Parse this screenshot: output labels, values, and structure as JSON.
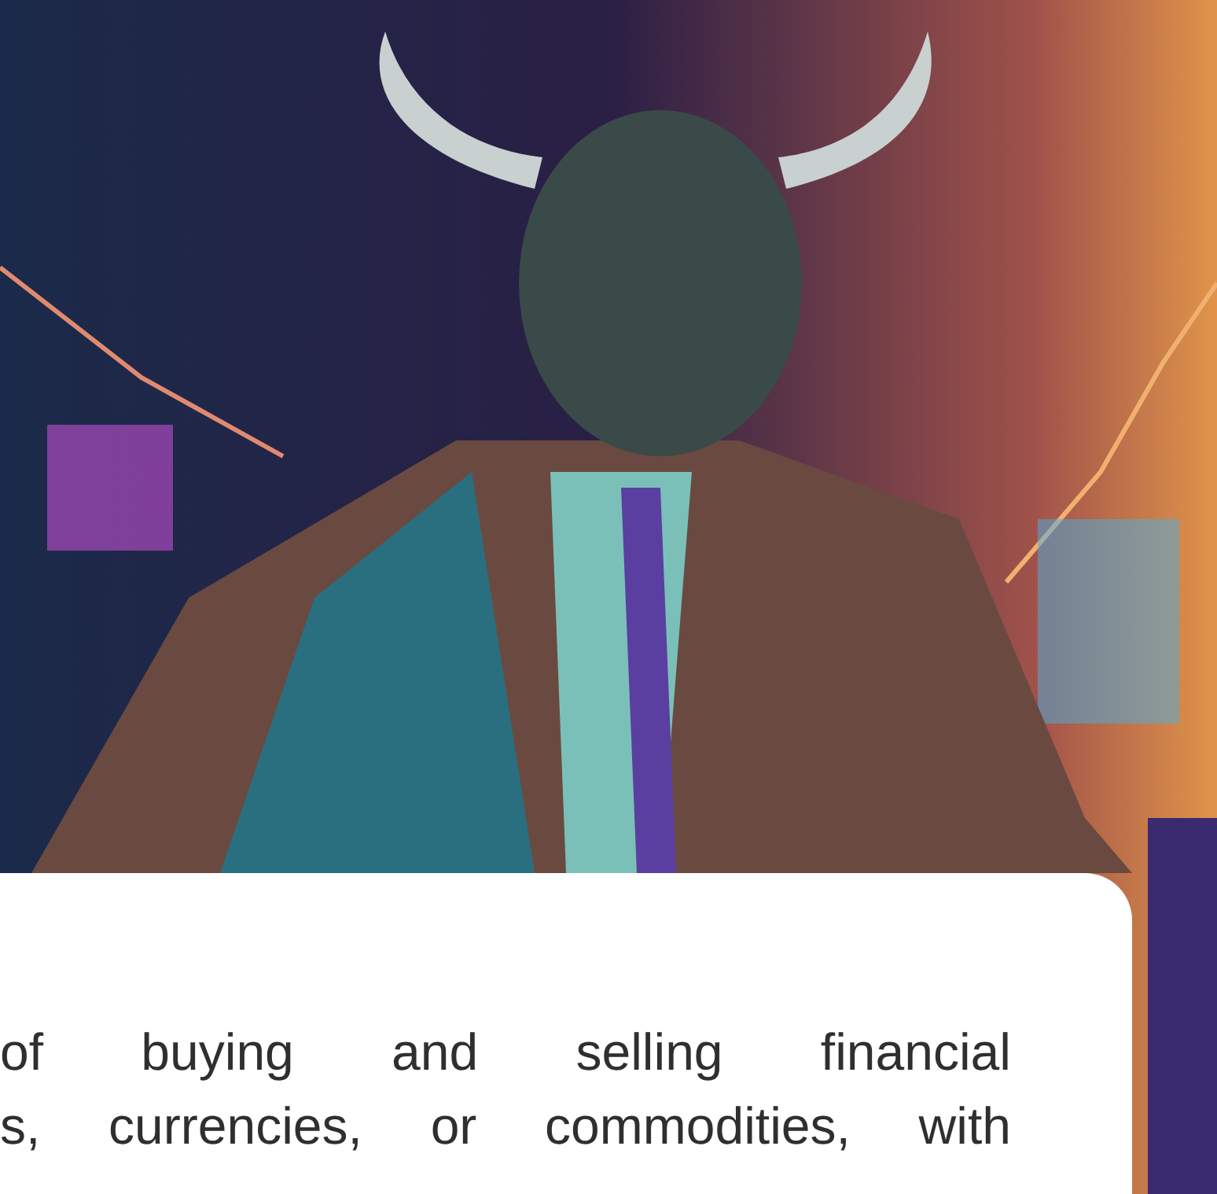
{
  "card": {
    "paragraph_lines": [
      "of buying and selling financial",
      "s, currencies, or commodities, with"
    ]
  }
}
